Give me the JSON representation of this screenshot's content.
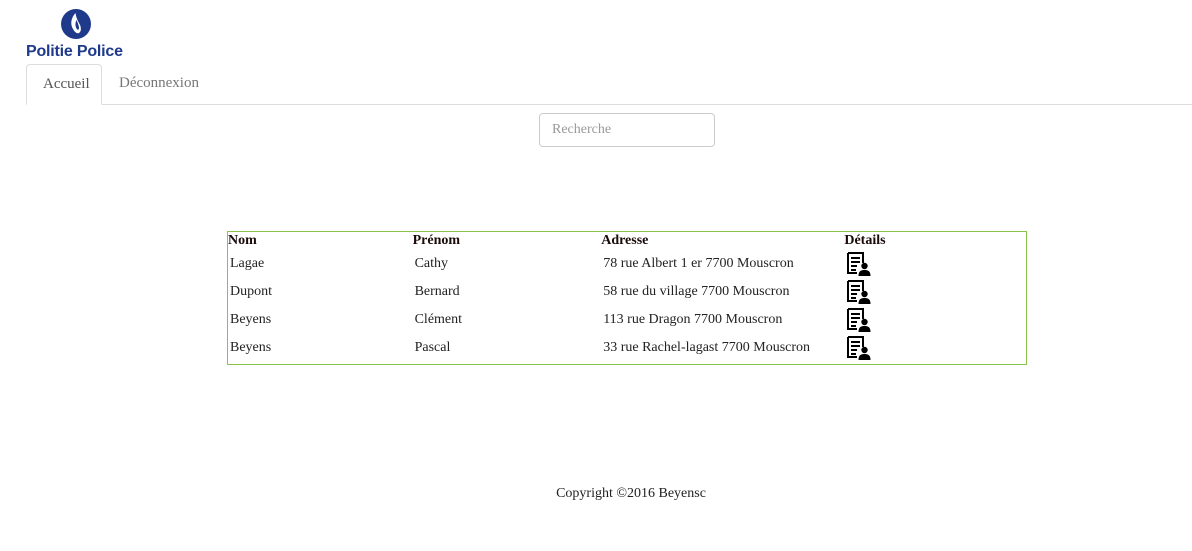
{
  "header": {
    "logo_text": "Politie Police",
    "logo_icon": "flame-emblem-icon",
    "brand_color": "#1f3a8a"
  },
  "tabs": [
    {
      "label": "Accueil",
      "active": true
    },
    {
      "label": "Déconnexion",
      "active": false
    }
  ],
  "search": {
    "placeholder": "Recherche",
    "value": ""
  },
  "table": {
    "border_color": "#8bc34a",
    "headers": {
      "nom": "Nom",
      "prenom": "Prénom",
      "adresse": "Adresse",
      "details": "Détails"
    },
    "details_icon": "person-details-icon",
    "rows": [
      {
        "nom": "Lagae",
        "prenom": "Cathy",
        "adresse": "78  rue  Albert 1 er 7700 Mouscron"
      },
      {
        "nom": "Dupont",
        "prenom": "Bernard",
        "adresse": "58  rue   du village 7700 Mouscron"
      },
      {
        "nom": "Beyens",
        "prenom": "Clément",
        "adresse": "113  rue  Dragon 7700 Mouscron"
      },
      {
        "nom": "Beyens",
        "prenom": "Pascal",
        "adresse": "33  rue  Rachel-lagast 7700 Mouscron"
      }
    ]
  },
  "footer": {
    "copyright": "Copyright ©2016 Beyensc"
  }
}
